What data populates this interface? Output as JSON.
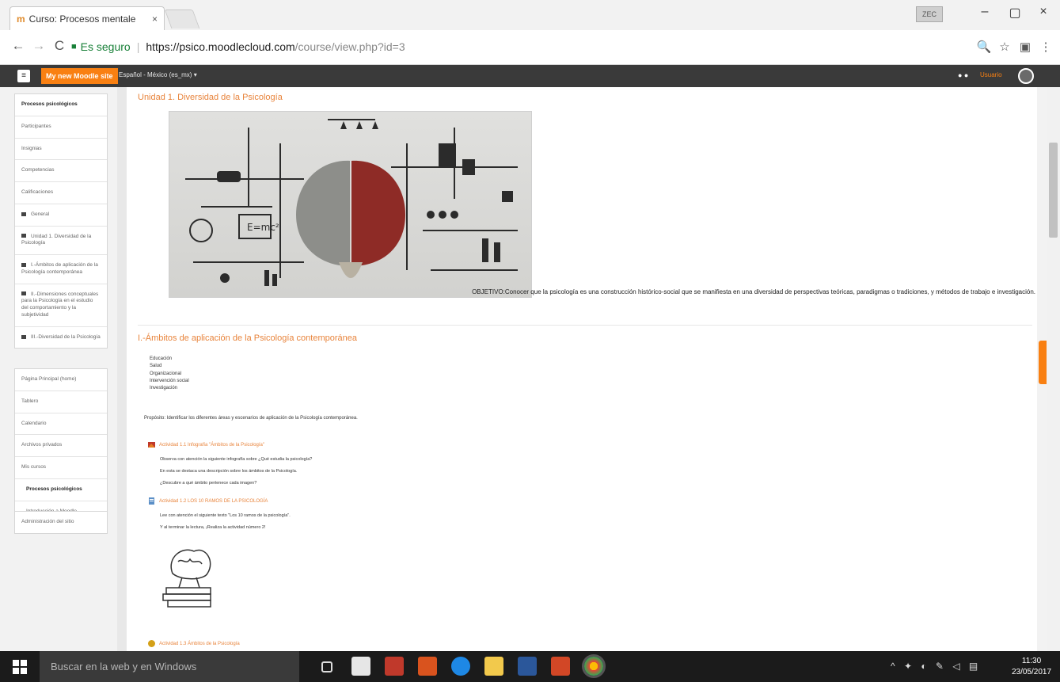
{
  "browser": {
    "tab_title": "Curso: Procesos mentale",
    "tab_close": "×",
    "user_chip": "ZEC",
    "address": {
      "secure_label": "Es seguro",
      "url_main": "https://psico.moodlecloud.com",
      "url_rest": "/course/view.php?id=3"
    },
    "nav": {
      "back": "←",
      "forward": "→",
      "reload": "C"
    },
    "window": {
      "minimize": "–",
      "restore": "▢",
      "close": "×"
    },
    "right_icons": {
      "zoom": "🔍",
      "star": "☆",
      "ext": "▣",
      "menu": "⋮"
    }
  },
  "moodle": {
    "brand": "My new Moodle site",
    "language": "Español - México (es_mx) ▾",
    "user": "Usuario",
    "sidebar_block1": [
      {
        "label": "Procesos psicológicos",
        "bold": true
      },
      {
        "label": "Participantes"
      },
      {
        "label": "Insignias"
      },
      {
        "label": "Competencias"
      },
      {
        "label": "Calificaciones"
      },
      {
        "label": "General",
        "folder": true
      },
      {
        "label": "Unidad 1. Diversidad de la Psicología",
        "folder": true
      },
      {
        "label": "I.-Ámbitos de aplicación de la Psicología contemporánea",
        "folder": true
      },
      {
        "label": "II.-Dimensiones conceptuales para la Psicología en el estudio del comportamiento y la subjetividad",
        "folder": true
      },
      {
        "label": "III.-Diversidad de la Psicología",
        "folder": true
      }
    ],
    "sidebar_block2": [
      {
        "label": "Página Principal (home)"
      },
      {
        "label": "Tablero"
      },
      {
        "label": "Calendario"
      },
      {
        "label": "Archivos privados"
      },
      {
        "label": "Mis cursos"
      },
      {
        "label": "Procesos psicológicos",
        "bold": true,
        "sub": true
      },
      {
        "label": "Introducción a Moodle",
        "sub": true
      }
    ],
    "sidebar_block3": [
      {
        "label": "Administración del sitio"
      }
    ]
  },
  "content": {
    "unit_title": "Unidad 1. Diversidad de la Psicología",
    "objective": "OBJETIVO:Conocer que la psicología es una construcción histórico-social que se manifiesta en una diversidad de perspectivas teóricas, paradigmas o tradiciones, y métodos de trabajo e investigación.",
    "section_title": "I.-Ámbitos de aplicación de la Psicología contemporánea",
    "areas": [
      "Educación",
      "Salud",
      "Organizacional",
      "Intervención social",
      "Investigación"
    ],
    "purpose": "Propósito: Identificar los diferentes áreas y escenarios de aplicación de la Psicología contemporánea.",
    "activity1": {
      "title": "Actividad 1.1 Infografía \"Ámbitos de la Psicología\"",
      "lines": [
        "Observa con atención la siguiente infografía sobre ¿Qué estudia la psicología?",
        "En esta se destaca una descripción sobre los ámbitos de la Psicología.",
        "¿Descubre a qué ámbito pertenece cada imagen?"
      ]
    },
    "activity2": {
      "title": "Actividad 1.2 LOS 10 RAMOS DE LA PSICOLOGÍA",
      "lines": [
        "Lee con atención el siguiente texto \"Los 10 ramos de la psicología\".",
        "Y al terminar la lectura, ¡Realiza la actividad número 2!"
      ]
    },
    "activity3": {
      "title": "Actividad 1.3 Ámbitos de la Psicología"
    }
  },
  "taskbar": {
    "search_placeholder": "Buscar en la web y en Windows",
    "time": "11:30",
    "date": "23/05/2017"
  },
  "colors": {
    "accent_orange": "#f98012",
    "heading_orange": "#e8843c",
    "navbar": "#3a3a3a",
    "secure_green": "#188038"
  }
}
